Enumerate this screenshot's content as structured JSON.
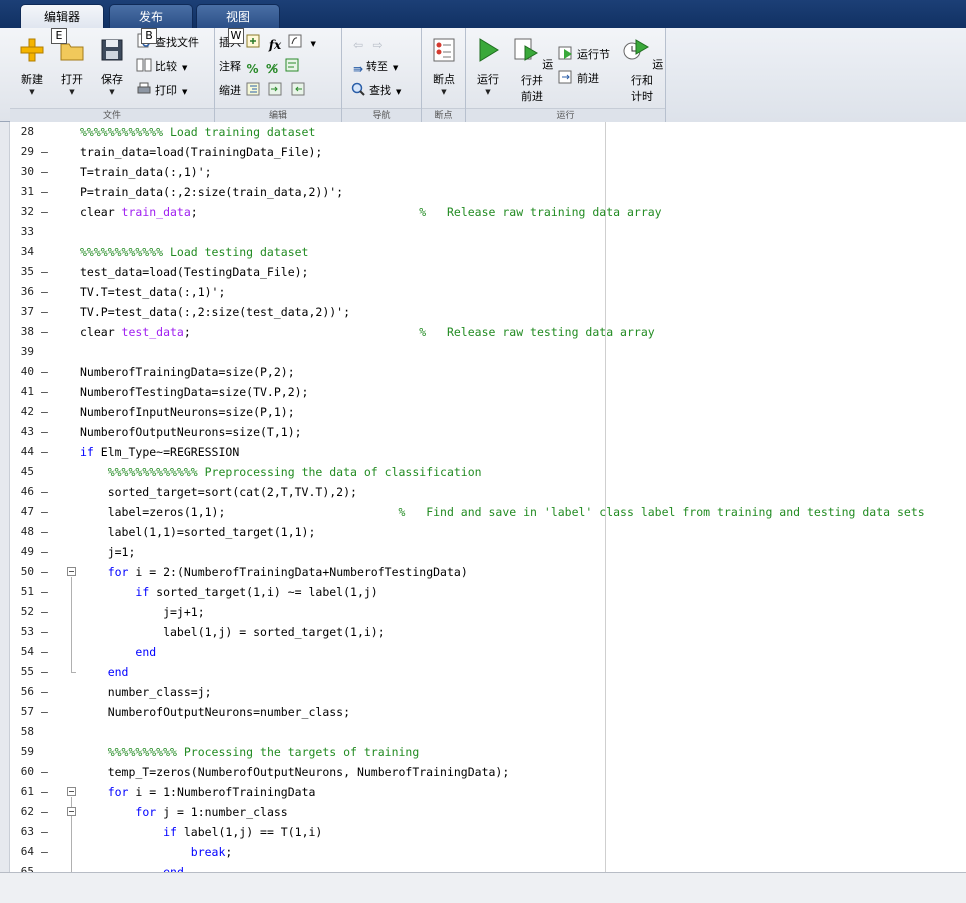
{
  "tabs": [
    {
      "label": "编辑器",
      "key": "E"
    },
    {
      "label": "发布",
      "key": "B"
    },
    {
      "label": "视图",
      "key": "W"
    }
  ],
  "ribbon": {
    "file": {
      "new": "新建",
      "open": "打开",
      "save": "保存",
      "find_files": "查找文件",
      "compare": "比较",
      "print": "打印",
      "label": "文件"
    },
    "edit": {
      "insert": "插入",
      "comment": "注释",
      "indent": "缩进",
      "fx": "fx",
      "label": "编辑"
    },
    "navigate": {
      "goto": "转至",
      "find": "查找",
      "label": "导航"
    },
    "breakpoints": {
      "breakpoints": "断点",
      "label": "断点"
    },
    "run": {
      "run": "运行",
      "run_advance_1": "运行并",
      "run_advance_2": "前进",
      "run_section": "运行节",
      "advance": "前进",
      "run_time_1": "运行和",
      "run_time_2": "计时",
      "label": "运行"
    }
  },
  "editor": {
    "lines": [
      {
        "n": "28",
        "dash": "",
        "html": "<span class='cm'>%%%%%%%%%%%% Load training dataset</span>"
      },
      {
        "n": "29",
        "dash": "–",
        "html": "train_data=load(TrainingData_File);"
      },
      {
        "n": "30",
        "dash": "–",
        "html": "T=train_data(:,1)';"
      },
      {
        "n": "31",
        "dash": "–",
        "html": "P=train_data(:,2:size(train_data,2))';"
      },
      {
        "n": "32",
        "dash": "–",
        "html": "clear <span class='st'>train_data</span>;                                <span class='cm'>%   Release raw training data array</span>"
      },
      {
        "n": "33",
        "dash": "",
        "html": ""
      },
      {
        "n": "34",
        "dash": "",
        "html": "<span class='cm'>%%%%%%%%%%%% Load testing dataset</span>"
      },
      {
        "n": "35",
        "dash": "–",
        "html": "test_data=load(TestingData_File);"
      },
      {
        "n": "36",
        "dash": "–",
        "html": "TV.T=test_data(:,1)';"
      },
      {
        "n": "37",
        "dash": "–",
        "html": "TV.P=test_data(:,2:size(test_data,2))';"
      },
      {
        "n": "38",
        "dash": "–",
        "html": "clear <span class='st'>test_data</span>;                                 <span class='cm'>%   Release raw testing data array</span>"
      },
      {
        "n": "39",
        "dash": "",
        "html": ""
      },
      {
        "n": "40",
        "dash": "–",
        "html": "NumberofTrainingData=size(P,2);"
      },
      {
        "n": "41",
        "dash": "–",
        "html": "NumberofTestingData=size(TV.P,2);"
      },
      {
        "n": "42",
        "dash": "–",
        "html": "NumberofInputNeurons=size(P,1);"
      },
      {
        "n": "43",
        "dash": "–",
        "html": "NumberofOutputNeurons=size(T,1);"
      },
      {
        "n": "44",
        "dash": "–",
        "html": "<span class='kw'>if</span> Elm_Type~=REGRESSION"
      },
      {
        "n": "45",
        "dash": "",
        "html": "    <span class='cm'>%%%%%%%%%%%%% Preprocessing the data of classification</span>"
      },
      {
        "n": "46",
        "dash": "–",
        "html": "    sorted_target=sort(cat(2,T,TV.T),2);"
      },
      {
        "n": "47",
        "dash": "–",
        "html": "    label=zeros(1,1);                         <span class='cm'>%   Find and save in 'label' class label from training and testing data sets</span>"
      },
      {
        "n": "48",
        "dash": "–",
        "html": "    label(1,1)=sorted_target(1,1);"
      },
      {
        "n": "49",
        "dash": "–",
        "html": "    j=1;"
      },
      {
        "n": "50",
        "dash": "–",
        "html": "    <span class='kw'>for</span> i = 2:(NumberofTrainingData+NumberofTestingData)"
      },
      {
        "n": "51",
        "dash": "–",
        "html": "        <span class='kw'>if</span> sorted_target(1,i) ~= label(1,j)"
      },
      {
        "n": "52",
        "dash": "–",
        "html": "            j=j+1;"
      },
      {
        "n": "53",
        "dash": "–",
        "html": "            label(1,j) = sorted_target(1,i);"
      },
      {
        "n": "54",
        "dash": "–",
        "html": "        <span class='kw'>end</span>"
      },
      {
        "n": "55",
        "dash": "–",
        "html": "    <span class='kw'>end</span>"
      },
      {
        "n": "56",
        "dash": "–",
        "html": "    number_class=j;"
      },
      {
        "n": "57",
        "dash": "–",
        "html": "    NumberofOutputNeurons=number_class;"
      },
      {
        "n": "58",
        "dash": "",
        "html": ""
      },
      {
        "n": "59",
        "dash": "",
        "html": "    <span class='cm'>%%%%%%%%%% Processing the targets of training</span>"
      },
      {
        "n": "60",
        "dash": "–",
        "html": "    temp_T=zeros(NumberofOutputNeurons, NumberofTrainingData);"
      },
      {
        "n": "61",
        "dash": "–",
        "html": "    <span class='kw'>for</span> i = 1:NumberofTrainingData"
      },
      {
        "n": "62",
        "dash": "–",
        "html": "        <span class='kw'>for</span> j = 1:number_class"
      },
      {
        "n": "63",
        "dash": "–",
        "html": "            <span class='kw'>if</span> label(1,j) == T(1,i)"
      },
      {
        "n": "64",
        "dash": "–",
        "html": "                <span class='kw'>break</span>;"
      },
      {
        "n": "65",
        "dash": "–",
        "html": "            <span class='kw'>end</span>"
      }
    ]
  }
}
